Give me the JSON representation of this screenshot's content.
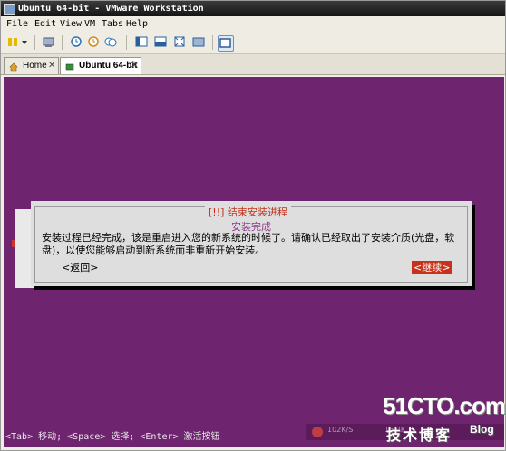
{
  "window": {
    "title": "Ubuntu 64-bit - VMware Workstation"
  },
  "menu": {
    "items": [
      "File",
      "Edit",
      "View",
      "VM",
      "Tabs",
      "Help"
    ]
  },
  "toolbar": {
    "icons": [
      "power-icon",
      "dropdown-icon",
      "send-ctrl-alt-del-icon",
      "snapshot-icon",
      "revert-snapshot-icon",
      "snapshot-manager-icon",
      "show-sidebar-icon",
      "quick-switch-icon",
      "fullscreen-icon",
      "unity-icon",
      "console-view-icon"
    ]
  },
  "tabs": [
    {
      "label": "Home",
      "close": "✕"
    },
    {
      "label": "Ubuntu 64-bit",
      "close": "✕"
    }
  ],
  "dialog": {
    "title": "[!!] 结束安装进程",
    "heading": "安装完成",
    "body": "安装过程已经完成，该是重启进入您的新系统的时候了。请确认已经取出了安装介质(光盘，软盘)，以使您能够启动到新系统而非重新开始安装。",
    "back_label": "<返回>",
    "continue_label": "<继续>"
  },
  "hint": "<Tab> 移动; <Space> 选择; <Enter> 激活按钮",
  "status": {
    "net": "102K/S",
    "speed": "16.2K"
  },
  "watermark": {
    "site": "51CTO.com",
    "sub": "技术博客",
    "blog": "Blog"
  },
  "colors": {
    "vm_background": "#6f2470",
    "dialog_title": "#c0321b",
    "continue_button": "#c8321b"
  }
}
